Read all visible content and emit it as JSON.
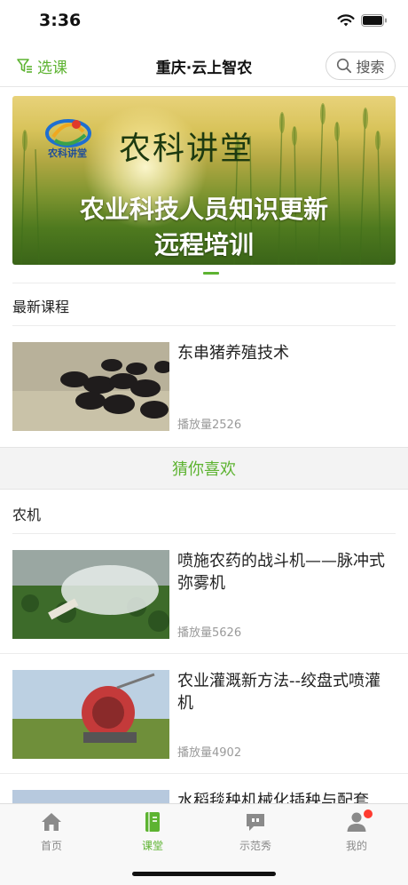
{
  "status_bar": {
    "time": "3:36"
  },
  "nav": {
    "filter_label": "选课",
    "title": "重庆·云上智农",
    "search_label": "搜索"
  },
  "banner": {
    "logo_text": "农科讲堂",
    "title": "农科讲堂",
    "line1": "农业科技人员知识更新",
    "line2": "远程培训"
  },
  "latest": {
    "heading": "最新课程",
    "items": [
      {
        "title": "东串猪养殖技术",
        "plays": "播放量2526"
      }
    ]
  },
  "guess": {
    "label": "猜你喜欢"
  },
  "category": {
    "heading": "农机",
    "items": [
      {
        "title": "喷施农药的战斗机——脉冲式弥雾机",
        "plays": "播放量5626"
      },
      {
        "title": "农业灌溉新方法--绞盘式喷灌机",
        "plays": "播放量4902"
      },
      {
        "title": "水稻毯秧机械化插秧与配套"
      }
    ]
  },
  "tabs": [
    {
      "label": "首页",
      "icon": "home-icon"
    },
    {
      "label": "课堂",
      "icon": "book-icon",
      "active": true
    },
    {
      "label": "示范秀",
      "icon": "chat-icon"
    },
    {
      "label": "我的",
      "icon": "user-icon",
      "badge": true
    }
  ],
  "colors": {
    "accent": "#5db331",
    "badge": "#ff3b30",
    "muted": "#9a9a9a"
  }
}
